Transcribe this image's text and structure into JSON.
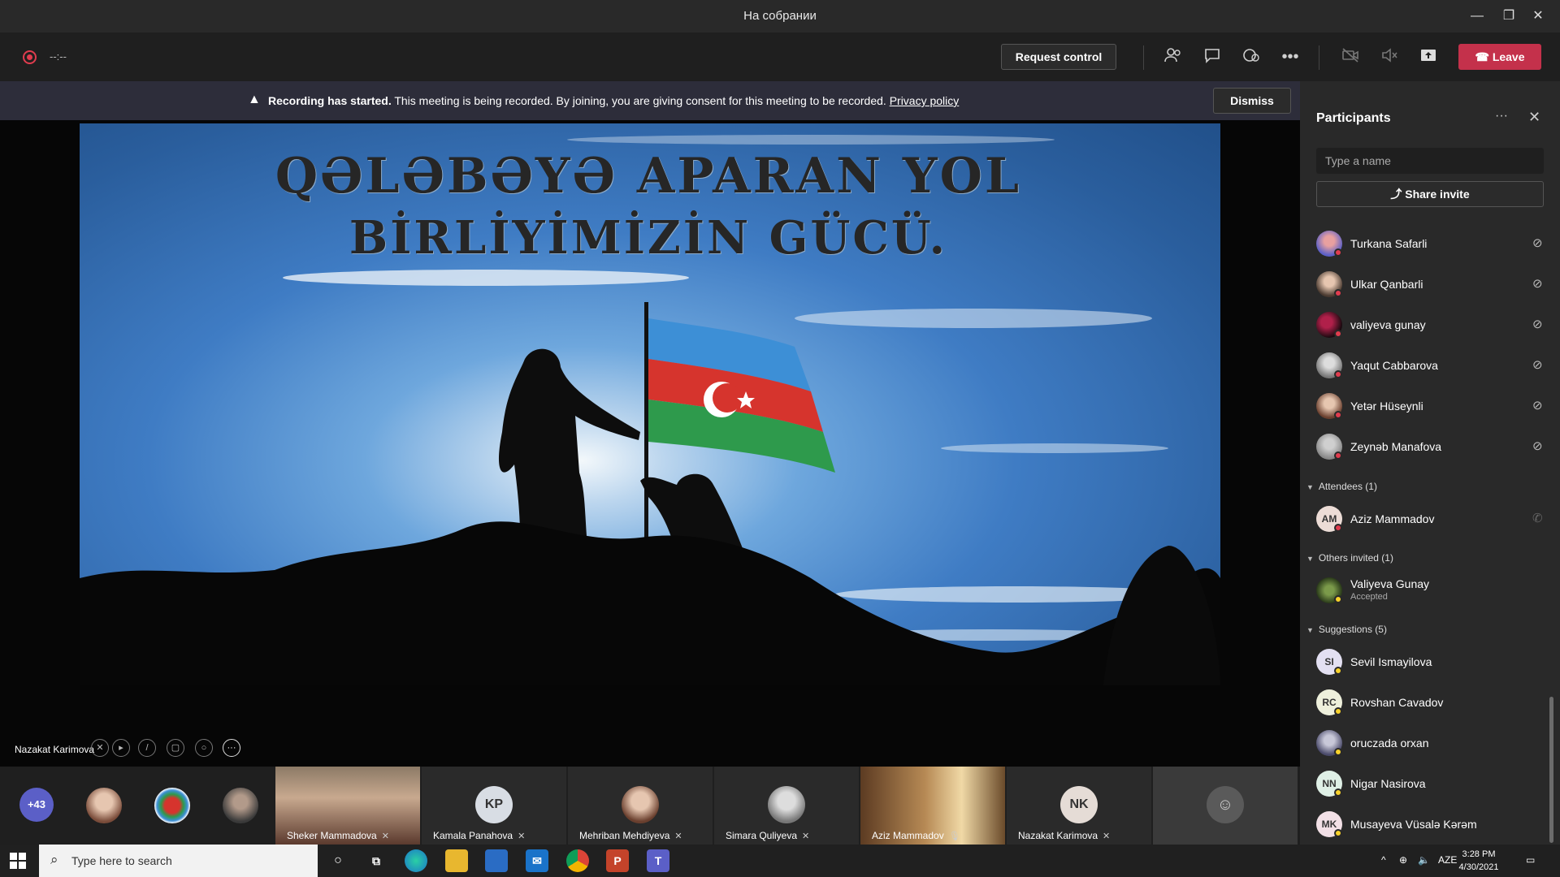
{
  "window": {
    "title": "На собрании",
    "minimize": "—",
    "restore": "❐",
    "close": "✕"
  },
  "toolbar": {
    "timer": "--:--",
    "request_control": "Request control",
    "leave": "Leave",
    "icons": [
      "participants-icon",
      "chat-icon",
      "reactions-icon",
      "more-icon",
      "camera-off-icon",
      "speaker-mute-icon",
      "share-screen-icon"
    ]
  },
  "banner": {
    "bold_text": "Recording has started.",
    "text": "This meeting is being recorded. By joining, you are giving consent for this meeting to be recorded.",
    "link": "Privacy policy",
    "dismiss": "Dismiss"
  },
  "slide": {
    "title_line1": "QƏLƏBƏYƏ APARAN YOL",
    "title_line2": "BİRLİYİMİZİN GÜCÜ."
  },
  "presenter": {
    "name": "Nazakat Karimova"
  },
  "filmstrip": {
    "overflow_count": "+43",
    "tiles": [
      {
        "name": "Sheker Mammadova"
      },
      {
        "name": "Kamala Panahova",
        "initials": "KP"
      },
      {
        "name": "Mehriban Mehdiyeva"
      },
      {
        "name": "Simara Quliyeva"
      },
      {
        "name": "Aziz Mammadov"
      },
      {
        "name": "Nazakat Karimova",
        "initials": "NK"
      }
    ]
  },
  "panel": {
    "title": "Participants",
    "more": "···",
    "close": "✕",
    "search_placeholder": "Type a name",
    "share_invite": "Share invite",
    "in_meeting": [
      {
        "name": "Turkana Safarli"
      },
      {
        "name": "Ulkar Qanbarli"
      },
      {
        "name": "valiyeva gunay"
      },
      {
        "name": "Yaqut Cabbarova"
      },
      {
        "name": "Yetər Hüseynli"
      },
      {
        "name": "Zeynəb Manafova"
      }
    ],
    "attendees_header": "Attendees (1)",
    "attendees": [
      {
        "name": "Aziz Mammadov",
        "initials": "AM"
      }
    ],
    "others_header": "Others invited (1)",
    "others": [
      {
        "name": "Valiyeva Gunay",
        "status": "Accepted"
      }
    ],
    "suggestions_header": "Suggestions (5)",
    "suggestions": [
      {
        "name": "Sevil Ismayilova",
        "initials": "SI"
      },
      {
        "name": "Rovshan Cavadov",
        "initials": "RC"
      },
      {
        "name": "oruczada orxan"
      },
      {
        "name": "Nigar Nasirova",
        "initials": "NN"
      },
      {
        "name": "Musayeva Vüsalə Kərəm",
        "initials": "MK"
      }
    ]
  },
  "taskbar": {
    "search_placeholder": "Type here to search",
    "language": "AZE",
    "time": "3:28 PM",
    "date": "4/30/2021"
  },
  "colors": {
    "leave": "#c4314b",
    "accent": "#5b5fc7",
    "recording": "#e03c4e"
  }
}
